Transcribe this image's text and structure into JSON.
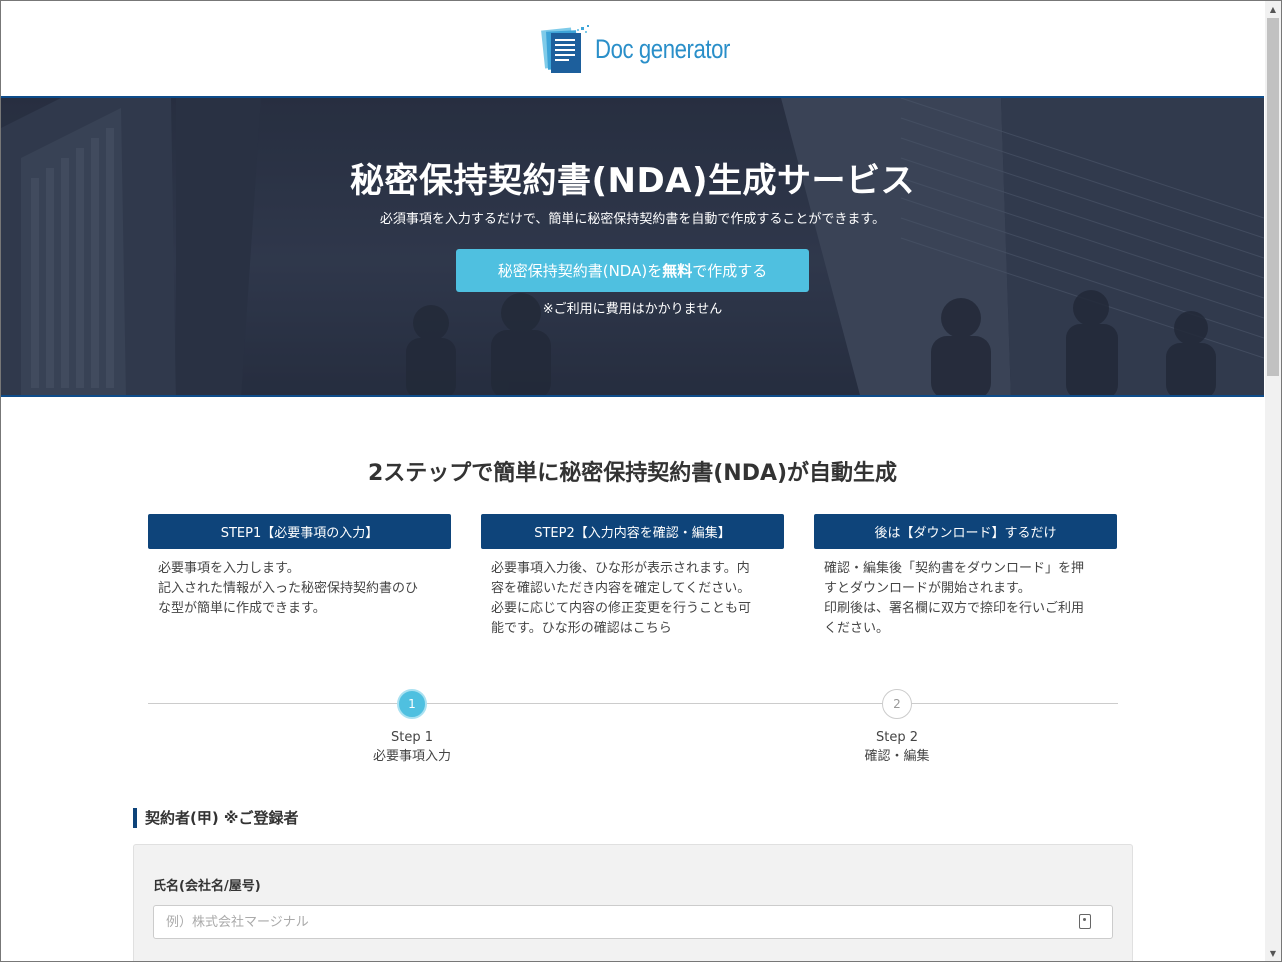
{
  "header": {
    "logo_text": "Doc generator",
    "logo_icon": "document-stack-icon"
  },
  "hero": {
    "title": "秘密保持契約書(NDA)生成サービス",
    "subtitle": "必須事項を入力するだけで、簡単に秘密保持契約書を自動で作成することができます。",
    "cta_prefix": "秘密保持契約書(NDA)を",
    "cta_bold": "無料",
    "cta_suffix": "で作成する",
    "note": "※ご利用に費用はかかりません"
  },
  "steps_section": {
    "title": "2ステップで簡単に秘密保持契約書(NDA)が自動生成",
    "cards": [
      {
        "heading": "STEP1【必要事項の入力】",
        "lines": [
          "必要事項を入力します。",
          "記入された情報が入った秘密保持契約書のひ",
          "な型が簡単に作成できます。"
        ]
      },
      {
        "heading": "STEP2【入力内容を確認・編集】",
        "lines": [
          "必要事項入力後、ひな形が表示されます。内",
          "容を確認いただき内容を確定してください。",
          "必要に応じて内容の修正変更を行うことも可",
          "能です。ひな形の確認はこちら"
        ]
      },
      {
        "heading": "後は【ダウンロード】するだけ",
        "lines": [
          "確認・編集後「契約書をダウンロード」を押",
          "すとダウンロードが開始されます。",
          "印刷後は、署名欄に双方で捺印を行いご利用",
          "ください。"
        ]
      }
    ]
  },
  "progress": {
    "steps": [
      {
        "number": "1",
        "label": "Step 1",
        "desc": "必要事項入力",
        "active": true
      },
      {
        "number": "2",
        "label": "Step 2",
        "desc": "確認・編集",
        "active": false
      }
    ]
  },
  "form": {
    "section_heading": "契約者(甲) ※ご登録者",
    "name_label": "氏名(会社名/屋号)",
    "name_placeholder": "例）株式会社マージナル",
    "name_value": "",
    "input_icon": "contact-card-icon"
  },
  "colors": {
    "primary_dark": "#0e447a",
    "accent": "#4fc0e0",
    "logo_blue": "#2a8fc9"
  }
}
